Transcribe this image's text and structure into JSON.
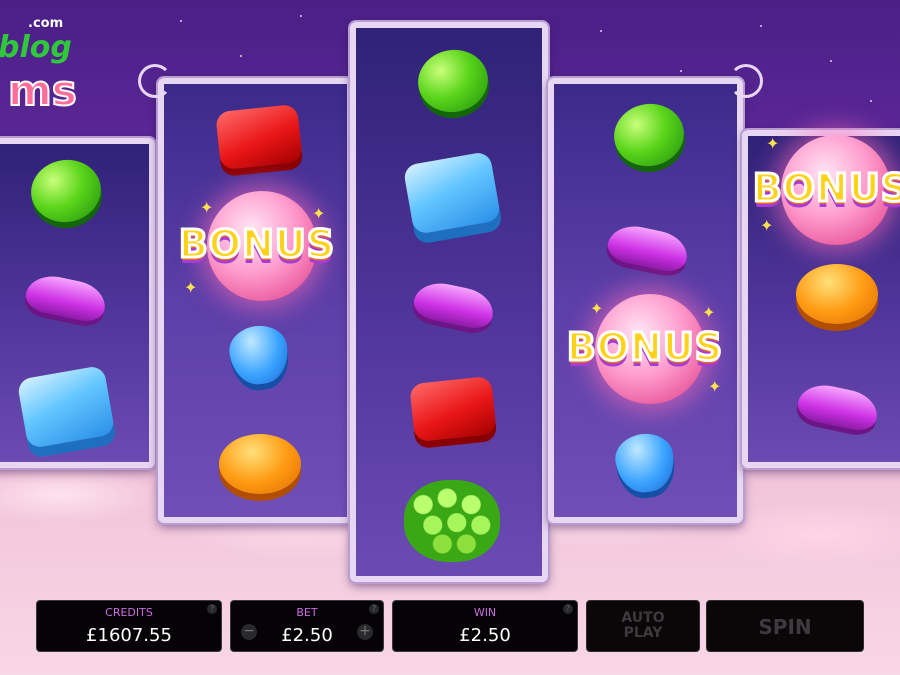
{
  "logo": {
    "domain": ".com",
    "brand_top": "blog",
    "brand_bottom": "ms"
  },
  "symbols": {
    "bonus_text": "BONUS"
  },
  "reels": [
    [
      "green-candy",
      "purple-bean",
      "blue-ice-cube"
    ],
    [
      "red-jelly",
      "bonus",
      "blue-drop",
      "orange-candy"
    ],
    [
      "green-candy",
      "blue-ice-cube",
      "purple-bean",
      "red-jelly",
      "green-berry"
    ],
    [
      "green-candy",
      "purple-bean",
      "bonus",
      "blue-drop"
    ],
    [
      "bonus",
      "orange-candy",
      "purple-bean"
    ]
  ],
  "status_bar": {
    "credits_label": "CREDITS",
    "credits_value": "£1607.55",
    "bet_label": "BET",
    "bet_value": "£2.50",
    "bet_minus": "−",
    "bet_plus": "+",
    "win_label": "WIN",
    "win_value": "£2.50",
    "help": "?",
    "autoplay_line1": "AUTO",
    "autoplay_line2": "PLAY",
    "spin_label": "SPIN"
  },
  "colors": {
    "label_accent": "#c86fe0",
    "panel_bg": "#050305",
    "reel_frame": "#e7d7f2"
  }
}
